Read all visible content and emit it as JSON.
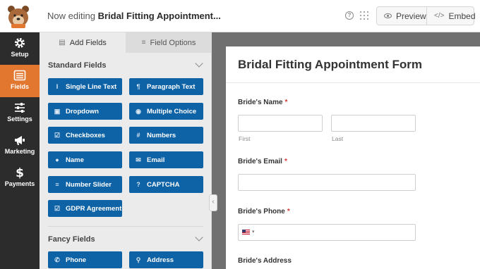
{
  "header": {
    "editing_prefix": "Now editing",
    "form_name": "Bridal Fitting Appointment...",
    "preview_label": "Preview",
    "embed_label": "Embed",
    "help_icon": "question-circle-icon",
    "grid_icon": "grid-dots-icon"
  },
  "nav": {
    "items": [
      {
        "label": "Setup",
        "icon": "gear-icon"
      },
      {
        "label": "Fields",
        "icon": "list-icon"
      },
      {
        "label": "Settings",
        "icon": "sliders-icon"
      },
      {
        "label": "Marketing",
        "icon": "megaphone-icon"
      },
      {
        "label": "Payments",
        "icon": "dollar-icon"
      }
    ],
    "active_color": "#e27730"
  },
  "panel": {
    "tab_add": "Add Fields",
    "tab_options": "Field Options",
    "standard_title": "Standard Fields",
    "fancy_title": "Fancy Fields",
    "standard_fields": [
      {
        "label": "Single Line Text",
        "icon": "text-cursor-icon"
      },
      {
        "label": "Paragraph Text",
        "icon": "paragraph-icon"
      },
      {
        "label": "Dropdown",
        "icon": "dropdown-icon"
      },
      {
        "label": "Multiple Choice",
        "icon": "radio-icon"
      },
      {
        "label": "Checkboxes",
        "icon": "checkbox-icon"
      },
      {
        "label": "Numbers",
        "icon": "hash-icon"
      },
      {
        "label": "Name",
        "icon": "user-icon"
      },
      {
        "label": "Email",
        "icon": "envelope-icon"
      },
      {
        "label": "Number Slider",
        "icon": "slider-icon"
      },
      {
        "label": "CAPTCHA",
        "icon": "captcha-icon"
      },
      {
        "label": "GDPR Agreement",
        "icon": "checkbox-icon"
      }
    ],
    "fancy_fields": [
      {
        "label": "Phone",
        "icon": "phone-icon"
      },
      {
        "label": "Address",
        "icon": "map-pin-icon"
      }
    ],
    "button_color": "#0e62a6"
  },
  "form": {
    "title": "Bridal Fitting Appointment Form",
    "fields": {
      "name_label": "Bride's Name",
      "first_sublabel": "First",
      "last_sublabel": "Last",
      "email_label": "Bride's Email",
      "phone_label": "Bride's Phone",
      "address_label": "Bride's Address",
      "required_mark": "*"
    },
    "phone_flag_icon": "us-flag-icon"
  }
}
